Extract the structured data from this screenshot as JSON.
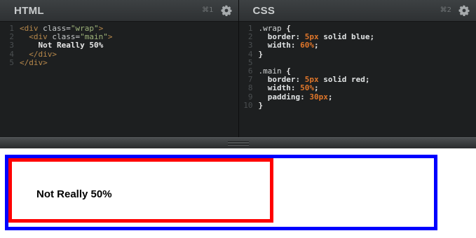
{
  "html_pane": {
    "title": "HTML",
    "shortcut": "⌘1",
    "lines": [
      {
        "num": "1",
        "tokens": [
          {
            "t": "<div ",
            "c": "tag"
          },
          {
            "t": "class=",
            "c": "attr"
          },
          {
            "t": "\"wrap\"",
            "c": "str"
          },
          {
            "t": ">",
            "c": "tag"
          }
        ]
      },
      {
        "num": "2",
        "tokens": [
          {
            "t": "  <div ",
            "c": "tag"
          },
          {
            "t": "class=",
            "c": "attr"
          },
          {
            "t": "\"main\"",
            "c": "str"
          },
          {
            "t": ">",
            "c": "tag"
          }
        ]
      },
      {
        "num": "3",
        "tokens": [
          {
            "t": "    Not Really 50%",
            "c": "text"
          }
        ]
      },
      {
        "num": "4",
        "tokens": [
          {
            "t": "  </div>",
            "c": "tag"
          }
        ]
      },
      {
        "num": "5",
        "tokens": [
          {
            "t": "</div>",
            "c": "tag"
          }
        ]
      }
    ]
  },
  "css_pane": {
    "title": "CSS",
    "shortcut": "⌘2",
    "lines": [
      {
        "num": "1",
        "tokens": [
          {
            "t": ".wrap ",
            "c": "sel"
          },
          {
            "t": "{",
            "c": "punc"
          }
        ]
      },
      {
        "num": "2",
        "tokens": [
          {
            "t": "  border: ",
            "c": "prop"
          },
          {
            "t": "5px",
            "c": "num"
          },
          {
            "t": " solid blue;",
            "c": "prop"
          }
        ]
      },
      {
        "num": "3",
        "tokens": [
          {
            "t": "  width: ",
            "c": "prop"
          },
          {
            "t": "60%",
            "c": "num"
          },
          {
            "t": ";",
            "c": "punc"
          }
        ]
      },
      {
        "num": "4",
        "tokens": [
          {
            "t": "}",
            "c": "punc"
          }
        ]
      },
      {
        "num": "5",
        "tokens": []
      },
      {
        "num": "6",
        "tokens": [
          {
            "t": ".main ",
            "c": "sel"
          },
          {
            "t": "{",
            "c": "punc"
          }
        ]
      },
      {
        "num": "7",
        "tokens": [
          {
            "t": "  border: ",
            "c": "prop"
          },
          {
            "t": "5px",
            "c": "num"
          },
          {
            "t": " solid red;",
            "c": "prop"
          }
        ]
      },
      {
        "num": "8",
        "tokens": [
          {
            "t": "  width: ",
            "c": "prop"
          },
          {
            "t": "50%",
            "c": "num"
          },
          {
            "t": ";",
            "c": "punc"
          }
        ]
      },
      {
        "num": "9",
        "tokens": [
          {
            "t": "  padding: ",
            "c": "prop"
          },
          {
            "t": "30px",
            "c": "num"
          },
          {
            "t": ";",
            "c": "punc"
          }
        ]
      },
      {
        "num": "10",
        "tokens": [
          {
            "t": "}",
            "c": "punc"
          }
        ]
      }
    ]
  },
  "preview": {
    "text": "Not Really 50%",
    "wrap_border_color": "#0000ff",
    "main_border_color": "#ff0000"
  },
  "icons": {
    "settings": "gear-icon",
    "resize": "resize-grip-icon"
  }
}
